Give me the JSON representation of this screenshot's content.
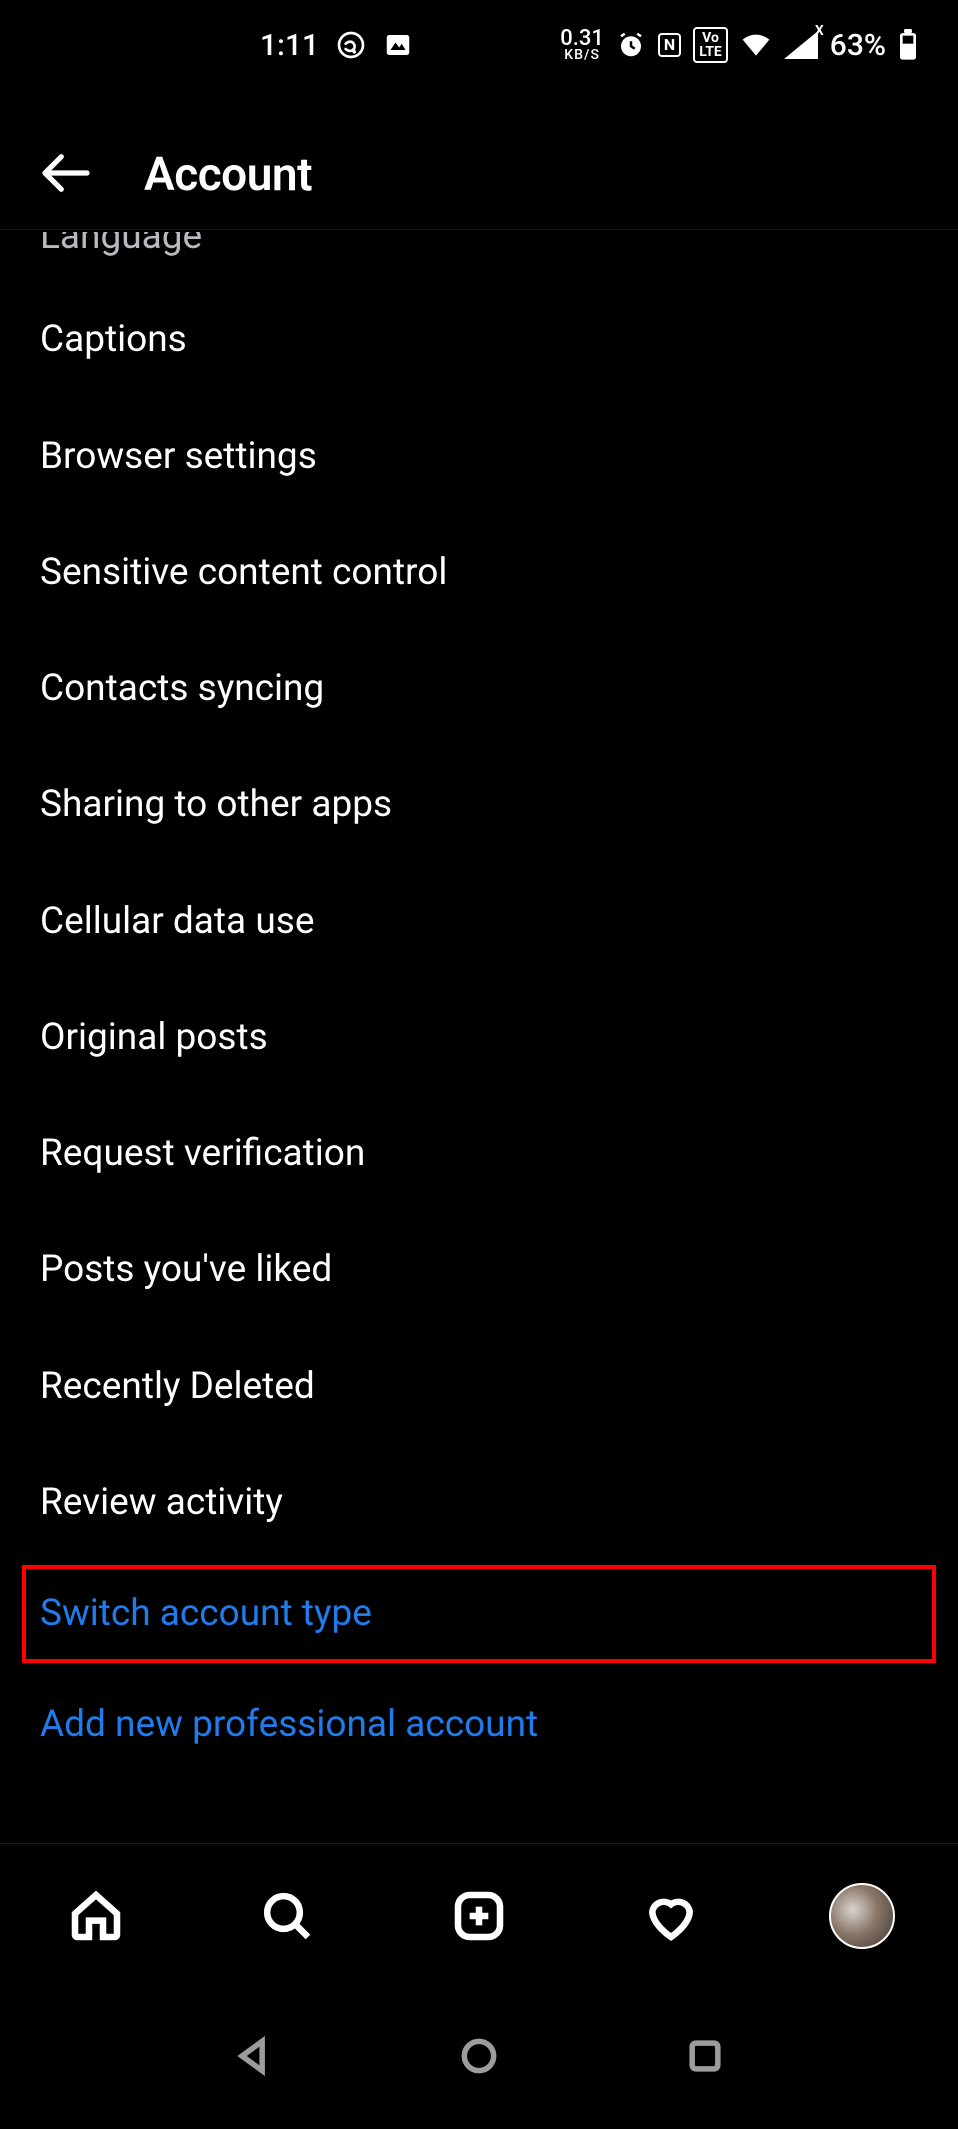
{
  "status_bar": {
    "time": "1:11",
    "data_rate_value": "0.31",
    "data_rate_unit": "KB/S",
    "nfc_label": "N",
    "volte_label": "Vo⍴\nLTE",
    "battery_percent": "63%"
  },
  "header": {
    "title": "Account"
  },
  "settings": {
    "items": [
      {
        "label": "Language",
        "partial": true,
        "link": false,
        "highlight": false
      },
      {
        "label": "Captions",
        "partial": false,
        "link": false,
        "highlight": false
      },
      {
        "label": "Browser settings",
        "partial": false,
        "link": false,
        "highlight": false
      },
      {
        "label": "Sensitive content control",
        "partial": false,
        "link": false,
        "highlight": false
      },
      {
        "label": "Contacts syncing",
        "partial": false,
        "link": false,
        "highlight": false
      },
      {
        "label": "Sharing to other apps",
        "partial": false,
        "link": false,
        "highlight": false
      },
      {
        "label": "Cellular data use",
        "partial": false,
        "link": false,
        "highlight": false
      },
      {
        "label": "Original posts",
        "partial": false,
        "link": false,
        "highlight": false
      },
      {
        "label": "Request verification",
        "partial": false,
        "link": false,
        "highlight": false
      },
      {
        "label": "Posts you've liked",
        "partial": false,
        "link": false,
        "highlight": false
      },
      {
        "label": "Recently Deleted",
        "partial": false,
        "link": false,
        "highlight": false
      },
      {
        "label": "Review activity",
        "partial": false,
        "link": false,
        "highlight": false
      },
      {
        "label": "Switch account type",
        "partial": false,
        "link": true,
        "highlight": true
      },
      {
        "label": "Add new professional account",
        "partial": false,
        "link": true,
        "highlight": false
      }
    ]
  },
  "colors": {
    "link_blue": "#1f7cec",
    "highlight_red": "#ff0000"
  }
}
